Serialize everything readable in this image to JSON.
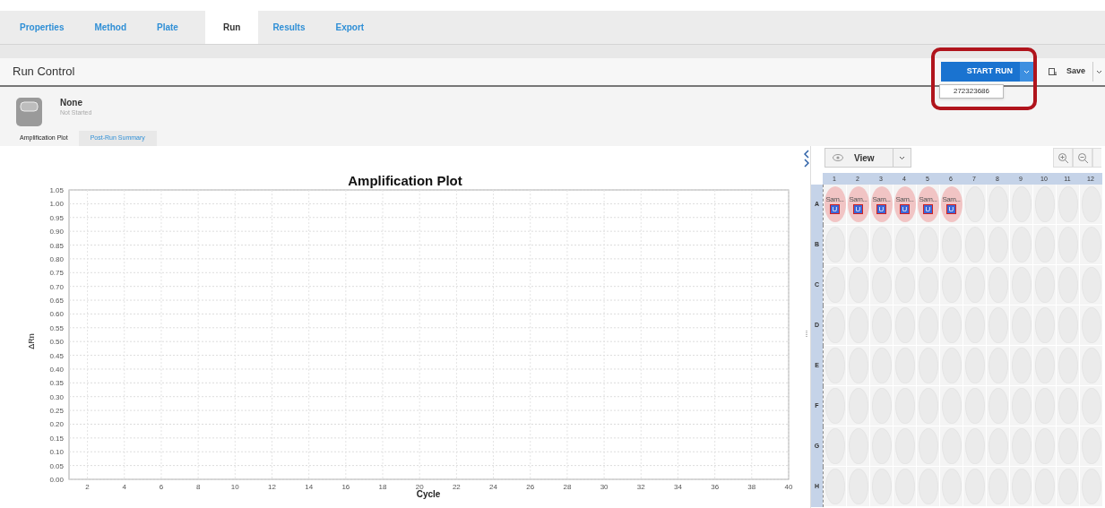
{
  "nav_tabs": [
    {
      "label": "Properties",
      "selected": false
    },
    {
      "label": "Method",
      "selected": false
    },
    {
      "label": "Plate",
      "selected": false
    },
    {
      "label": "Run",
      "selected": true
    },
    {
      "label": "Results",
      "selected": false
    },
    {
      "label": "Export",
      "selected": false
    }
  ],
  "header": {
    "title": "Run Control",
    "start_button": "START RUN",
    "instrument_option": "272323686",
    "save_button": "Save"
  },
  "instrument": {
    "name": "None",
    "status": "Not Started"
  },
  "view_tabs": [
    {
      "label": "Amplification Plot",
      "selected": true
    },
    {
      "label": "Post-Run Summary",
      "selected": false
    }
  ],
  "chart": {
    "chart_data": {
      "type": "line",
      "title": "Amplification Plot",
      "xlabel": "Cycle",
      "ylabel": "ΔRn",
      "xlim": [
        1,
        40
      ],
      "ylim": [
        0,
        1.05
      ],
      "xticks": [
        2,
        4,
        6,
        8,
        10,
        12,
        14,
        16,
        18,
        20,
        22,
        24,
        26,
        28,
        30,
        32,
        34,
        36,
        38,
        40
      ],
      "yticks": [
        {
          "value": 0,
          "label": "0.00"
        },
        {
          "value": 0.05,
          "label": "0.05"
        },
        {
          "value": 0.1,
          "label": "0.10"
        },
        {
          "value": 0.15,
          "label": "0.15"
        },
        {
          "value": 0.2,
          "label": "0.20"
        },
        {
          "value": 0.25,
          "label": "0.25"
        },
        {
          "value": 0.3,
          "label": "0.30"
        },
        {
          "value": 0.35,
          "label": "0.35"
        },
        {
          "value": 0.4,
          "label": "0.40"
        },
        {
          "value": 0.45,
          "label": "0.45"
        },
        {
          "value": 0.5,
          "label": "0.50"
        },
        {
          "value": 0.55,
          "label": "0.55"
        },
        {
          "value": 0.6,
          "label": "0.60"
        },
        {
          "value": 0.65,
          "label": "0.65"
        },
        {
          "value": 0.7,
          "label": "0.70"
        },
        {
          "value": 0.75,
          "label": "0.75"
        },
        {
          "value": 0.8,
          "label": "0.80"
        },
        {
          "value": 0.85,
          "label": "0.85"
        },
        {
          "value": 0.9,
          "label": "0.90"
        },
        {
          "value": 0.95,
          "label": "0.95"
        },
        {
          "value": 1.0,
          "label": "1.00"
        },
        {
          "value": 1.05,
          "label": "1.05"
        }
      ],
      "grid": true
    }
  },
  "plate": {
    "view_button": "View",
    "columns": [
      "1",
      "2",
      "3",
      "4",
      "5",
      "6",
      "7",
      "8",
      "9",
      "10",
      "11",
      "12"
    ],
    "rows": [
      {
        "label": "A",
        "samples": [
          {
            "label": "Sam...",
            "task": "U"
          },
          {
            "label": "Sam...",
            "task": "U"
          },
          {
            "label": "Sam...",
            "task": "U"
          },
          {
            "label": "Sam...",
            "task": "U"
          },
          {
            "label": "Sam...",
            "task": "U"
          },
          {
            "label": "Sam...",
            "task": "U"
          }
        ]
      },
      {
        "label": "B"
      },
      {
        "label": "C"
      },
      {
        "label": "D"
      },
      {
        "label": "E"
      },
      {
        "label": "F"
      },
      {
        "label": "G"
      },
      {
        "label": "H"
      }
    ]
  }
}
